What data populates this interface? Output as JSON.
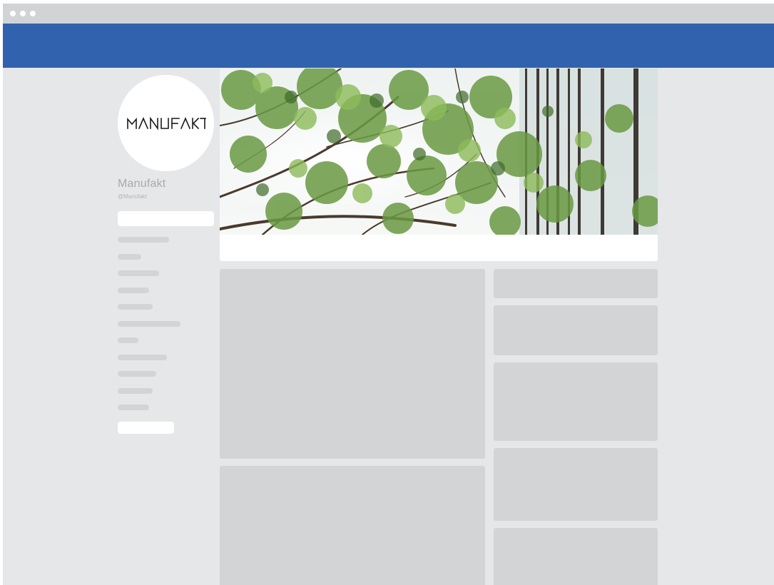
{
  "window": {
    "controls": [
      "window-dot",
      "window-dot",
      "window-dot"
    ]
  },
  "profile": {
    "logo_text": "MANUFAKT",
    "name": "Manufakt",
    "handle": "@Manufakt"
  },
  "colors": {
    "topbar": "#3162ad",
    "background": "#e6e7e9",
    "placeholder": "#d3d4d6",
    "titlebar": "#d2d3d5"
  },
  "icons": [
    "window-dot-icon",
    "brand-logo"
  ]
}
